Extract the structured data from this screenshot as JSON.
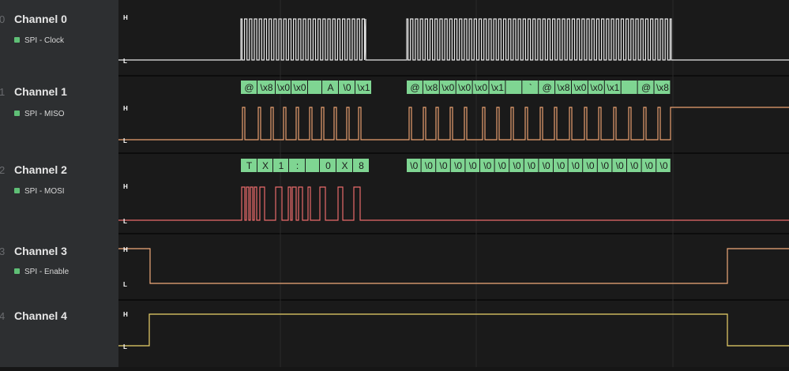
{
  "channels": [
    {
      "index": "0",
      "name": "Channel 0",
      "analyzer": "SPI - Clock"
    },
    {
      "index": "1",
      "name": "Channel 1",
      "analyzer": "SPI - MISO"
    },
    {
      "index": "2",
      "name": "Channel 2",
      "analyzer": "SPI - MOSI"
    },
    {
      "index": "3",
      "name": "Channel 3",
      "analyzer": "SPI - Enable"
    },
    {
      "index": "4",
      "name": "Channel 4",
      "analyzer": ""
    }
  ],
  "levels": {
    "high": "H",
    "low": "L"
  },
  "colors": {
    "clock": "#e8e8e8",
    "miso": "#e9a070",
    "mosi": "#e96b6b",
    "enable": "#f0aa7a",
    "ch4": "#ecd36a",
    "decode_bg": "#7fd592",
    "analyzer_dot": "#5fbf76"
  },
  "decodes": {
    "miso": [
      "@",
      "\\x8",
      "\\x0",
      "\\x0",
      "",
      "A",
      "\\0",
      "\\x1",
      "@",
      "\\x8",
      "\\x0",
      "\\x0",
      "\\x0",
      "\\x1",
      "",
      "`",
      "@",
      "\\x8",
      "\\x0",
      "\\x0",
      "\\x1",
      "",
      "@",
      "\\x8"
    ],
    "mosi": [
      "T",
      "X",
      "1",
      ":",
      "",
      "0",
      "X",
      "8",
      "\\0",
      "\\0",
      "\\0",
      "\\0",
      "\\0",
      "\\0",
      "\\0",
      "\\0",
      "\\0",
      "\\0",
      "\\0",
      "\\0",
      "\\0",
      "\\0",
      "\\0",
      "\\0",
      "\\0",
      "\\0"
    ]
  }
}
